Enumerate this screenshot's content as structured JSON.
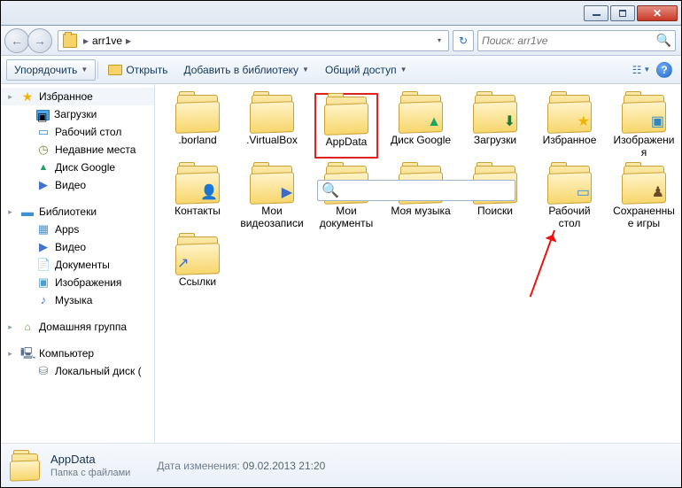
{
  "window": {
    "min_label": "",
    "max_label": "",
    "close_label": "✕"
  },
  "nav": {
    "back_label": "←",
    "fwd_label": "→",
    "breadcrumb_folder": "arr1ve",
    "breadcrumb_sep1": "▸",
    "breadcrumb_sep2": "▸",
    "dropdown": "▾",
    "refresh": "↻",
    "search_placeholder": "Поиск: arr1ve",
    "search_icon": "🔍"
  },
  "toolbar": {
    "organize": "Упорядочить",
    "open": "Открыть",
    "add_to_library": "Добавить в библиотеку",
    "share": "Общий доступ",
    "dd": "▼",
    "view_icon": "☷",
    "help": "?"
  },
  "sidebar": {
    "favorites": {
      "label": "Избранное",
      "exp": "▸"
    },
    "fav_items": [
      {
        "label": "Загрузки",
        "icon": "folder"
      },
      {
        "label": "Рабочий стол",
        "icon": "desk"
      },
      {
        "label": "Недавние места",
        "icon": "clock"
      },
      {
        "label": "Диск Google",
        "icon": "gd"
      },
      {
        "label": "Видео",
        "icon": "vid"
      }
    ],
    "libraries": {
      "label": "Библиотеки",
      "exp": "▸"
    },
    "lib_items": [
      {
        "label": "Apps",
        "icon": "app"
      },
      {
        "label": "Видео",
        "icon": "vid"
      },
      {
        "label": "Документы",
        "icon": "doc"
      },
      {
        "label": "Изображения",
        "icon": "img"
      },
      {
        "label": "Музыка",
        "icon": "mus"
      }
    ],
    "homegroup": {
      "label": "Домашняя группа",
      "exp": "▸"
    },
    "computer": {
      "label": "Компьютер",
      "exp": "▸"
    },
    "comp_items": [
      {
        "label": "Локальный диск (",
        "icon": "drive"
      }
    ]
  },
  "items": [
    {
      "label": ".borland",
      "overlay": ""
    },
    {
      "label": ".VirtualBox",
      "overlay": ""
    },
    {
      "label": "AppData",
      "overlay": "",
      "selected": true
    },
    {
      "label": "Диск Google",
      "overlay": "▲",
      "ov_class": "gd"
    },
    {
      "label": "Загрузки",
      "overlay": "⬇",
      "ov_class": "dl"
    },
    {
      "label": "Избранное",
      "overlay": "★",
      "ov_class": "star"
    },
    {
      "label": "Изображения",
      "overlay": "▣",
      "ov_class": "img"
    },
    {
      "label": "Контакты",
      "overlay": "👤",
      "ov_class": "people"
    },
    {
      "label": "Мои видеозаписи",
      "overlay": "▶",
      "ov_class": "vidic"
    },
    {
      "label": "Мои документы",
      "overlay": ""
    },
    {
      "label": "Моя музыка",
      "overlay": "♪",
      "ov_class": "mus"
    },
    {
      "label": "Поиски",
      "overlay": "🔍",
      "ov_class": "search"
    },
    {
      "label": "Рабочий стол",
      "overlay": "▭",
      "ov_class": "desk"
    },
    {
      "label": "Сохраненные игры",
      "overlay": "♟",
      "ov_class": "chess"
    },
    {
      "label": "Ссылки",
      "overlay": "↗",
      "ov_class": "link"
    }
  ],
  "status": {
    "name": "AppData",
    "sub": "Папка с файлами",
    "modified_label": "Дата изменения:",
    "modified_value": "09.02.2013 21:20"
  }
}
